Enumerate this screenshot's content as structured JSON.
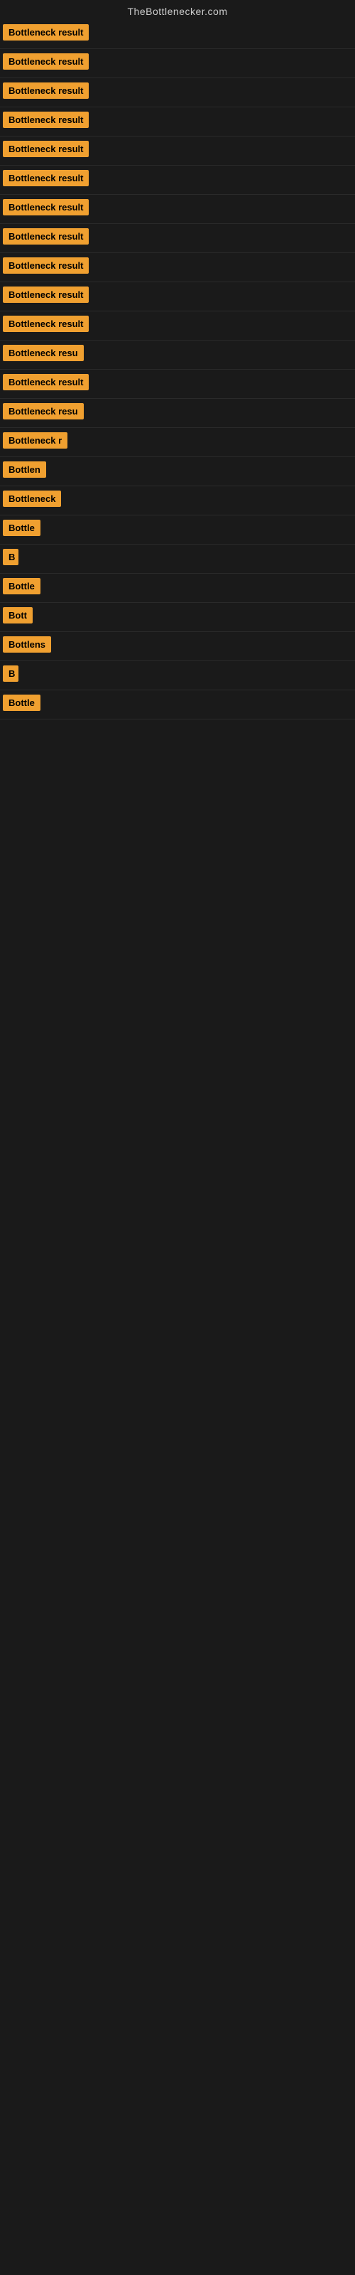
{
  "site": {
    "title": "TheBottlenecker.com"
  },
  "results": [
    {
      "id": 1,
      "label": "Bottleneck result",
      "visible_width": 160
    },
    {
      "id": 2,
      "label": "Bottleneck result",
      "visible_width": 160
    },
    {
      "id": 3,
      "label": "Bottleneck result",
      "visible_width": 160
    },
    {
      "id": 4,
      "label": "Bottleneck result",
      "visible_width": 160
    },
    {
      "id": 5,
      "label": "Bottleneck result",
      "visible_width": 160
    },
    {
      "id": 6,
      "label": "Bottleneck result",
      "visible_width": 160
    },
    {
      "id": 7,
      "label": "Bottleneck result",
      "visible_width": 160
    },
    {
      "id": 8,
      "label": "Bottleneck result",
      "visible_width": 160
    },
    {
      "id": 9,
      "label": "Bottleneck result",
      "visible_width": 160
    },
    {
      "id": 10,
      "label": "Bottleneck result",
      "visible_width": 155
    },
    {
      "id": 11,
      "label": "Bottleneck result",
      "visible_width": 158
    },
    {
      "id": 12,
      "label": "Bottleneck resu",
      "visible_width": 130
    },
    {
      "id": 13,
      "label": "Bottleneck result",
      "visible_width": 155
    },
    {
      "id": 14,
      "label": "Bottleneck resu",
      "visible_width": 130
    },
    {
      "id": 15,
      "label": "Bottleneck r",
      "visible_width": 100
    },
    {
      "id": 16,
      "label": "Bottlen",
      "visible_width": 75
    },
    {
      "id": 17,
      "label": "Bottleneck",
      "visible_width": 90
    },
    {
      "id": 18,
      "label": "Bottle",
      "visible_width": 65
    },
    {
      "id": 19,
      "label": "B",
      "visible_width": 22
    },
    {
      "id": 20,
      "label": "Bottle",
      "visible_width": 65
    },
    {
      "id": 21,
      "label": "Bott",
      "visible_width": 50
    },
    {
      "id": 22,
      "label": "Bottlens",
      "visible_width": 78
    },
    {
      "id": 23,
      "label": "B",
      "visible_width": 22
    },
    {
      "id": 24,
      "label": "Bottle",
      "visible_width": 65
    }
  ]
}
